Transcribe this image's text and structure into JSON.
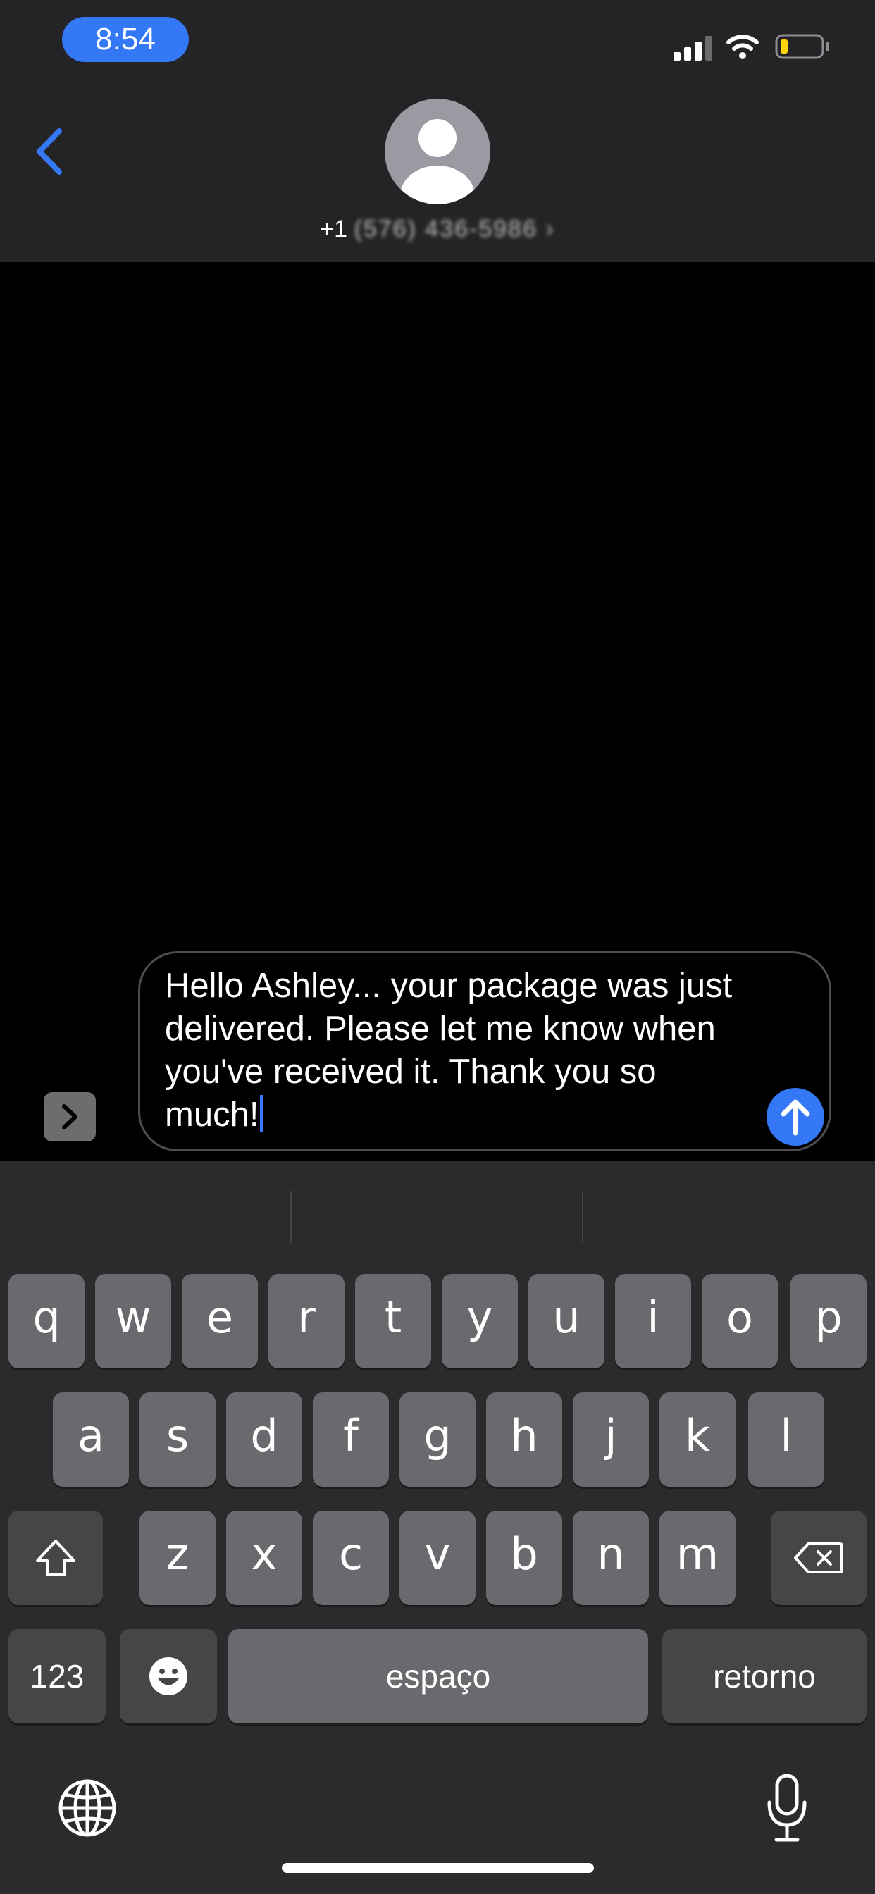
{
  "status_bar": {
    "time": "8:54"
  },
  "header": {
    "contact_prefix": "+1",
    "contact_number_obscured": "(576) 436-5986 ›"
  },
  "compose": {
    "message_text": "Hello Ashley... your package was just delivered. Please let me know when you've received it. Thank you so much!"
  },
  "keyboard": {
    "row1": [
      "q",
      "w",
      "e",
      "r",
      "t",
      "y",
      "u",
      "i",
      "o",
      "p"
    ],
    "row2": [
      "a",
      "s",
      "d",
      "f",
      "g",
      "h",
      "j",
      "k",
      "l"
    ],
    "row3": [
      "z",
      "x",
      "c",
      "v",
      "b",
      "n",
      "m"
    ],
    "numbers_label": "123",
    "space_label": "espaço",
    "return_label": "retorno"
  },
  "colors": {
    "accent": "#3478f6",
    "header_bg": "#242426",
    "keyboard_bg": "#2b2b2d",
    "key_bg": "#6a6a6e",
    "special_key_bg": "#464649"
  }
}
